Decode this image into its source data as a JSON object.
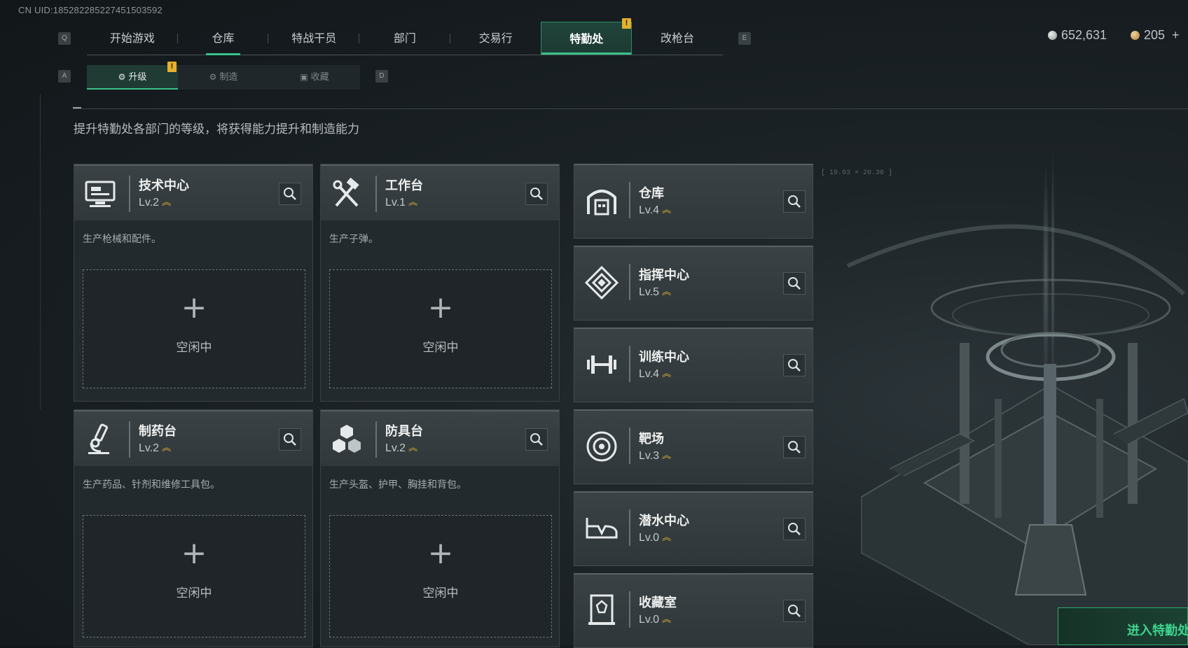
{
  "uid": "CN UID:18528228522745150359​2",
  "top_nav": {
    "prev_key": "Q",
    "next_key": "E",
    "tabs": [
      {
        "label": "开始游戏"
      },
      {
        "label": "仓库"
      },
      {
        "label": "特战干员"
      },
      {
        "label": "部门"
      },
      {
        "label": "交易行"
      },
      {
        "label": "特勤处"
      },
      {
        "label": "改枪台"
      }
    ],
    "badge": "!"
  },
  "currency": {
    "coins": "652,631",
    "tickets": "205",
    "add": "+"
  },
  "sub_nav": {
    "prev_key": "A",
    "next_key": "D",
    "tabs": [
      {
        "label": "升级"
      },
      {
        "label": "制造"
      },
      {
        "label": "收藏"
      }
    ],
    "badge": "!"
  },
  "description": "提升特勤处各部门的等级，将获得能力提升和制造能力",
  "production_stations": [
    {
      "title": "技术中心",
      "level": "Lv.2",
      "desc": "生产枪械和配件。",
      "slot_plus": "+",
      "slot_status": "空闲中"
    },
    {
      "title": "工作台",
      "level": "Lv.1",
      "desc": "生产子弹。",
      "slot_plus": "+",
      "slot_status": "空闲中"
    },
    {
      "title": "制药台",
      "level": "Lv.2",
      "desc": "生产药品、针剂和维修工具包。",
      "slot_plus": "+",
      "slot_status": "空闲中"
    },
    {
      "title": "防具台",
      "level": "Lv.2",
      "desc": "生产头盔、护甲、胸挂和背包。",
      "slot_plus": "+",
      "slot_status": "空闲中"
    }
  ],
  "facilities": [
    {
      "title": "仓库",
      "level": "Lv.4"
    },
    {
      "title": "指挥中心",
      "level": "Lv.5"
    },
    {
      "title": "训练中心",
      "level": "Lv.4"
    },
    {
      "title": "靶场",
      "level": "Lv.3"
    },
    {
      "title": "潜水中心",
      "level": "Lv.0"
    },
    {
      "title": "收藏室",
      "level": "Lv.0"
    }
  ],
  "coords_readout": "[ 19.93 × 20.36 ]",
  "enter_button": "进入特勤处",
  "colors": {
    "accent": "#37c189",
    "badge": "#e6b02c",
    "upgrade_chevron": "#e0b034"
  }
}
